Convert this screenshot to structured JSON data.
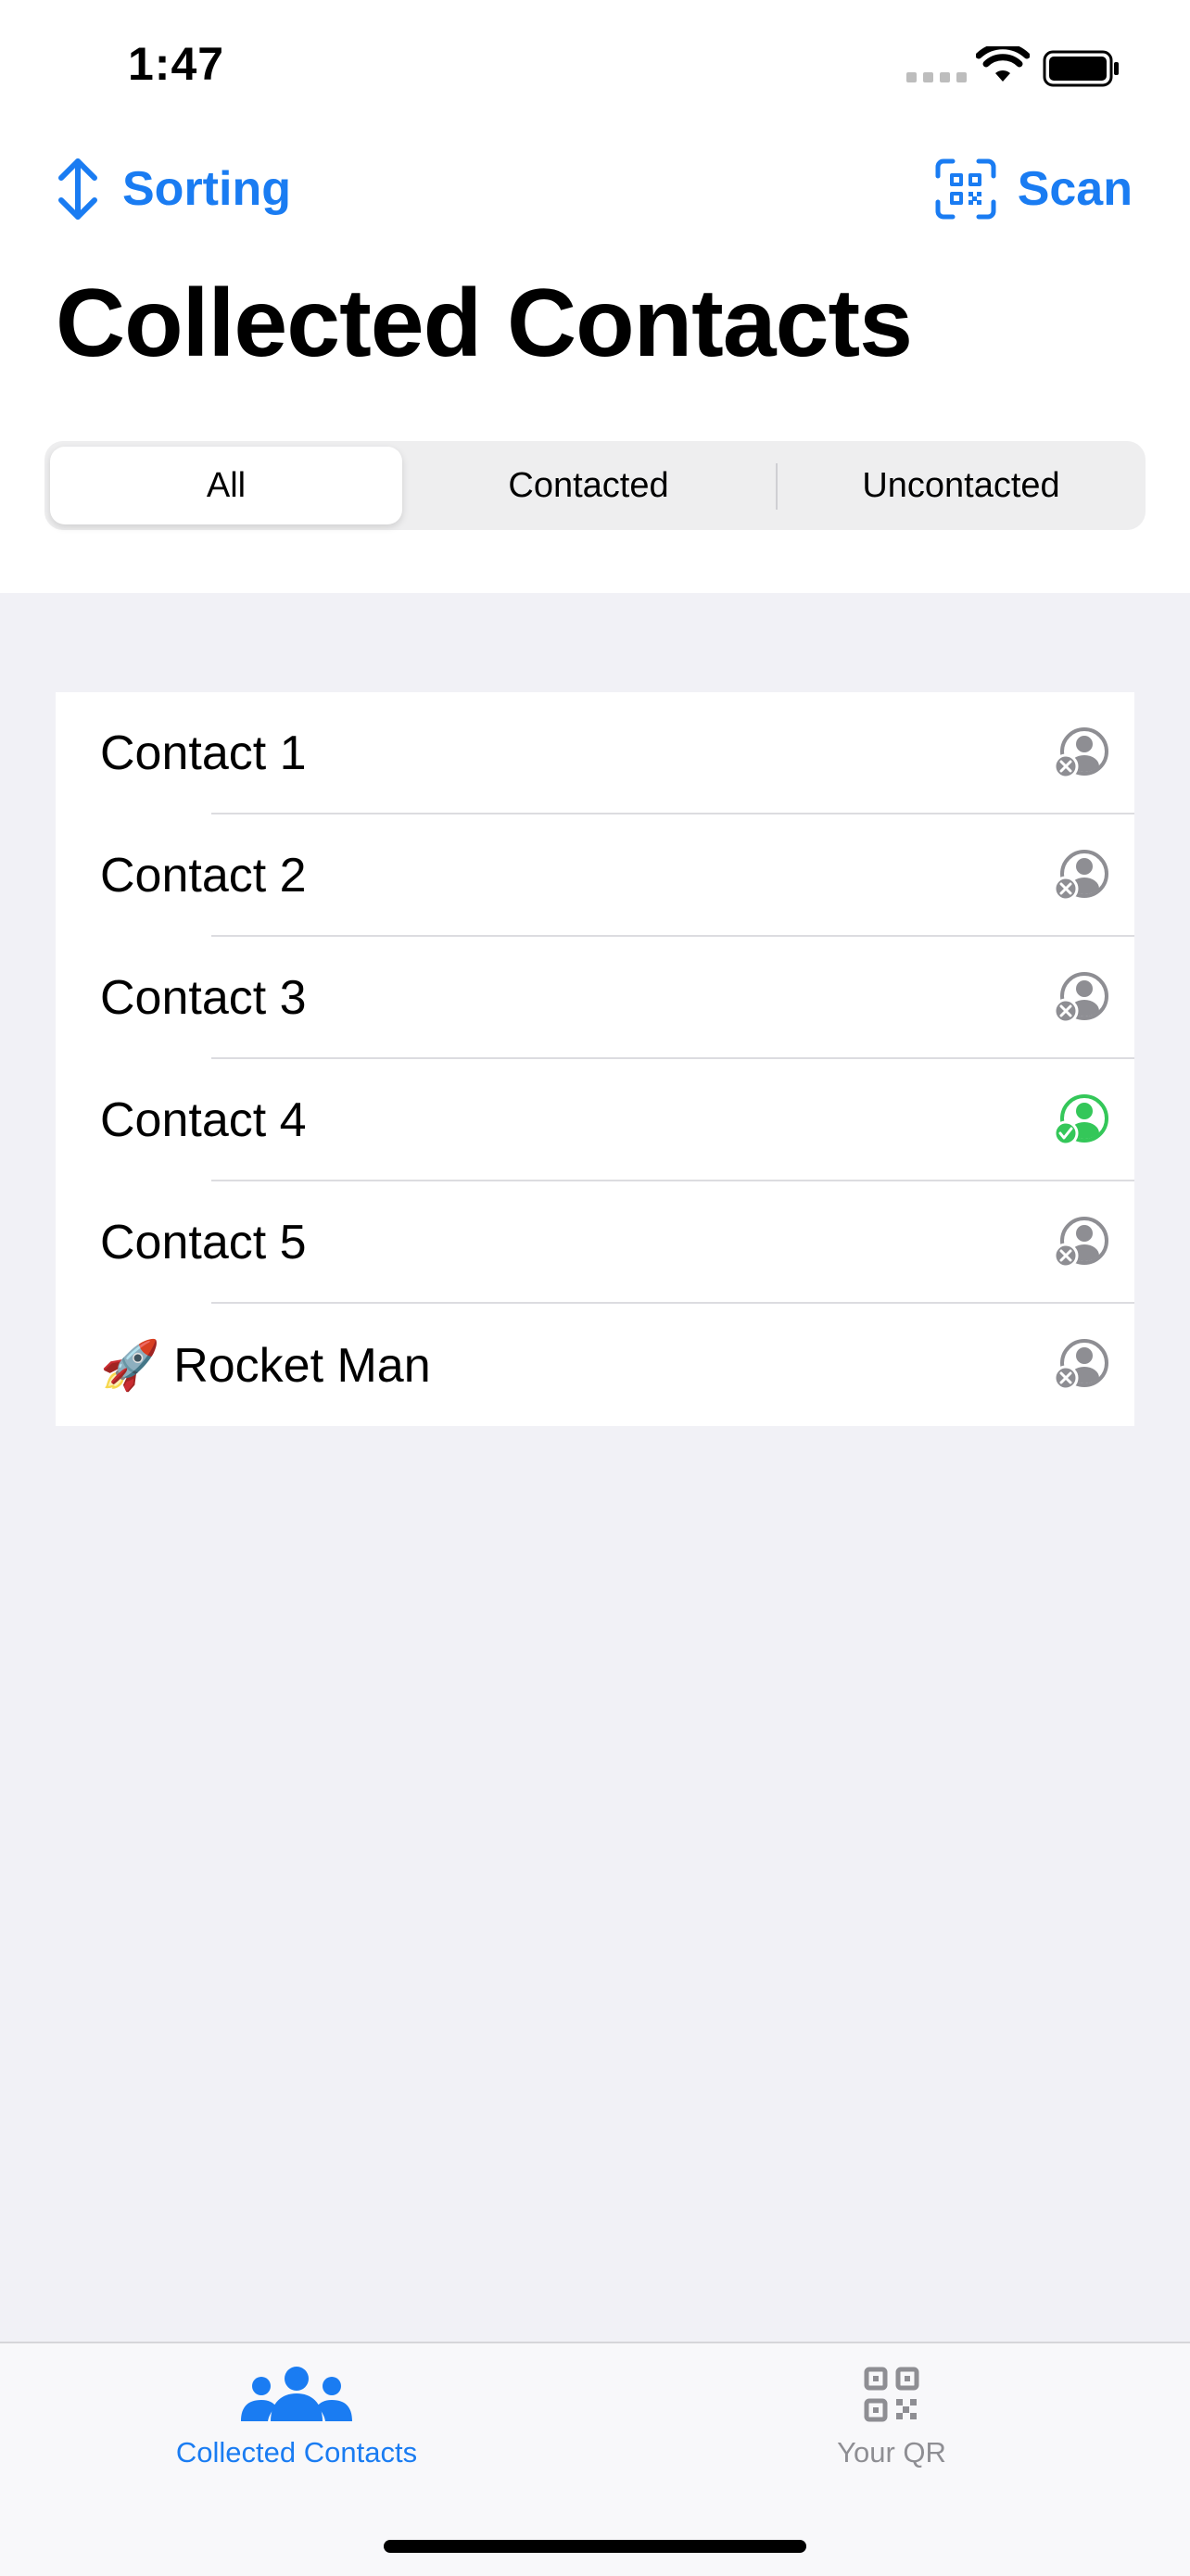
{
  "status_bar": {
    "time": "1:47"
  },
  "nav": {
    "sorting_label": "Sorting",
    "scan_label": "Scan"
  },
  "page": {
    "title": "Collected Contacts"
  },
  "segments": [
    {
      "label": "All",
      "selected": true
    },
    {
      "label": "Contacted",
      "selected": false
    },
    {
      "label": "Uncontacted",
      "selected": false
    }
  ],
  "contacts": [
    {
      "name": "Contact 1",
      "status": "uncontacted",
      "status_icon": "person-x-icon"
    },
    {
      "name": "Contact 2",
      "status": "uncontacted",
      "status_icon": "person-x-icon"
    },
    {
      "name": "Contact 3",
      "status": "uncontacted",
      "status_icon": "person-x-icon"
    },
    {
      "name": "Contact 4",
      "status": "contacted",
      "status_icon": "person-check-icon"
    },
    {
      "name": "Contact 5",
      "status": "uncontacted",
      "status_icon": "person-x-icon"
    },
    {
      "name": "🚀 Rocket Man",
      "status": "uncontacted",
      "status_icon": "person-x-icon"
    }
  ],
  "tab_bar": {
    "tabs": [
      {
        "label": "Collected Contacts",
        "icon": "people-icon",
        "selected": true
      },
      {
        "label": "Your QR",
        "icon": "qr-code-icon",
        "selected": false
      }
    ]
  },
  "colors": {
    "accent": "#1A7CF2",
    "contacted": "#34C759",
    "uncontacted": "#8E8E93",
    "background": "#F1F1F6"
  }
}
